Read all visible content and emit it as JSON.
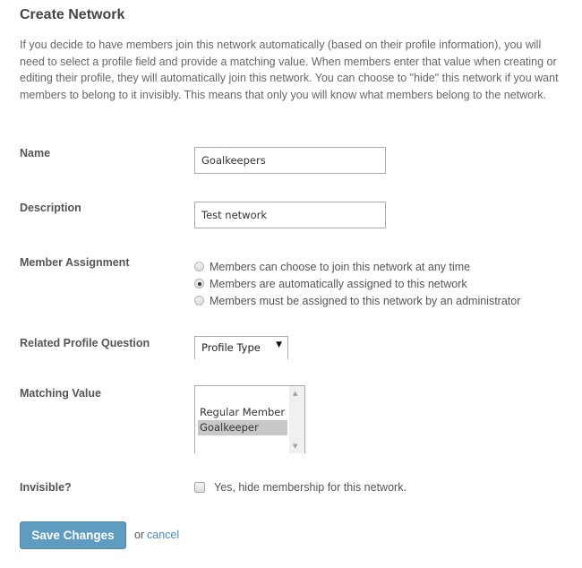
{
  "page": {
    "title": "Create Network",
    "intro": "If you decide to have members join this network automatically (based on their profile information), you will need to select a profile field and provide a matching value. When members enter that value when creating or editing their profile, they will automatically join this network. You can choose to \"hide\" this network if you want members to belong to it invisibly. This means that only you will know what members belong to the network."
  },
  "form": {
    "name": {
      "label": "Name",
      "value": "Goalkeepers"
    },
    "description": {
      "label": "Description",
      "value": "Test network"
    },
    "member_assignment": {
      "label": "Member Assignment",
      "options": [
        {
          "label": "Members can choose to join this network at any time",
          "checked": false
        },
        {
          "label": "Members are automatically assigned to this network",
          "checked": true
        },
        {
          "label": "Members must be assigned to this network by an administrator",
          "checked": false
        }
      ]
    },
    "related_profile_question": {
      "label": "Related Profile Question",
      "selected": "Profile Type"
    },
    "matching_value": {
      "label": "Matching Value",
      "options": [
        {
          "label": "Regular Member",
          "selected": false
        },
        {
          "label": "Goalkeeper",
          "selected": true
        }
      ]
    },
    "invisible": {
      "label": "Invisible?",
      "checkbox_label": "Yes, hide membership for this network.",
      "checked": false
    }
  },
  "actions": {
    "save_label": "Save Changes",
    "or_text": "or",
    "cancel_label": "cancel"
  },
  "colors": {
    "button_bg": "#5f9cbf",
    "link": "#4a8bc2",
    "selected_option_bg": "#c8c8c8"
  }
}
